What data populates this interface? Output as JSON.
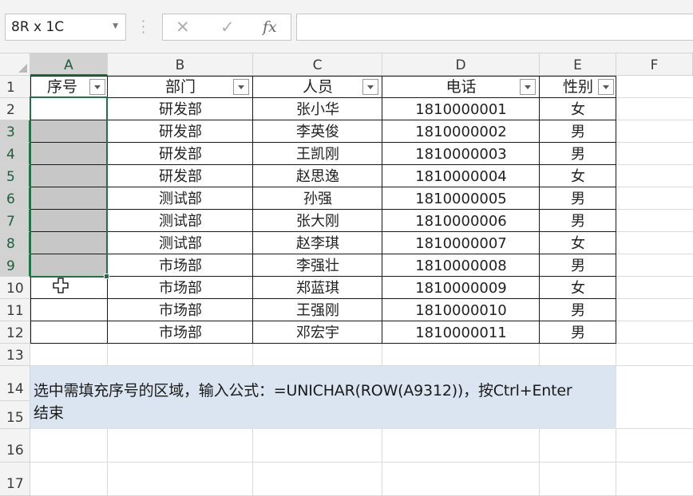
{
  "name_box": {
    "value": "8R x 1C"
  },
  "formula_bar": {
    "cancel_symbol": "✕",
    "enter_symbol": "✓",
    "fx_label": "fx",
    "formula_value": ""
  },
  "columns": [
    "A",
    "B",
    "C",
    "D",
    "E",
    "F"
  ],
  "rows": [
    "1",
    "2",
    "3",
    "4",
    "5",
    "6",
    "7",
    "8",
    "9",
    "10",
    "11",
    "12",
    "13",
    "14",
    "15",
    "16",
    "17"
  ],
  "table": {
    "headers": [
      "序号",
      "部门",
      "人员",
      "电话",
      "性别"
    ],
    "records": [
      {
        "seq": "",
        "dept": "研发部",
        "name": "张小华",
        "phone": "1810000001",
        "gender": "女"
      },
      {
        "seq": "",
        "dept": "研发部",
        "name": "李英俊",
        "phone": "1810000002",
        "gender": "男"
      },
      {
        "seq": "",
        "dept": "研发部",
        "name": "王凯刚",
        "phone": "1810000003",
        "gender": "男"
      },
      {
        "seq": "",
        "dept": "研发部",
        "name": "赵思逸",
        "phone": "1810000004",
        "gender": "女"
      },
      {
        "seq": "",
        "dept": "测试部",
        "name": "孙强",
        "phone": "1810000005",
        "gender": "男"
      },
      {
        "seq": "",
        "dept": "测试部",
        "name": "张大刚",
        "phone": "1810000006",
        "gender": "男"
      },
      {
        "seq": "",
        "dept": "测试部",
        "name": "赵李琪",
        "phone": "1810000007",
        "gender": "女"
      },
      {
        "seq": "",
        "dept": "市场部",
        "name": "李强壮",
        "phone": "1810000008",
        "gender": "男"
      },
      {
        "seq": "",
        "dept": "市场部",
        "name": "郑蓝琪",
        "phone": "1810000009",
        "gender": "女"
      },
      {
        "seq": "",
        "dept": "市场部",
        "name": "王强刚",
        "phone": "1810000010",
        "gender": "男"
      },
      {
        "seq": "",
        "dept": "市场部",
        "name": "邓宏宇",
        "phone": "1810000011",
        "gender": "男"
      }
    ]
  },
  "note": {
    "line1": "选中需填充序号的区域，输入公式：=UNICHAR(ROW(A9312))，按Ctrl+Enter",
    "line2": "结束"
  },
  "colors": {
    "selection_border": "#217346",
    "note_fill": "#dbe5f1",
    "selected_fill": "#c7c7c7"
  },
  "icons": {
    "cursor": "fill-cross-cursor",
    "filter": "filter-dropdown-icon"
  }
}
